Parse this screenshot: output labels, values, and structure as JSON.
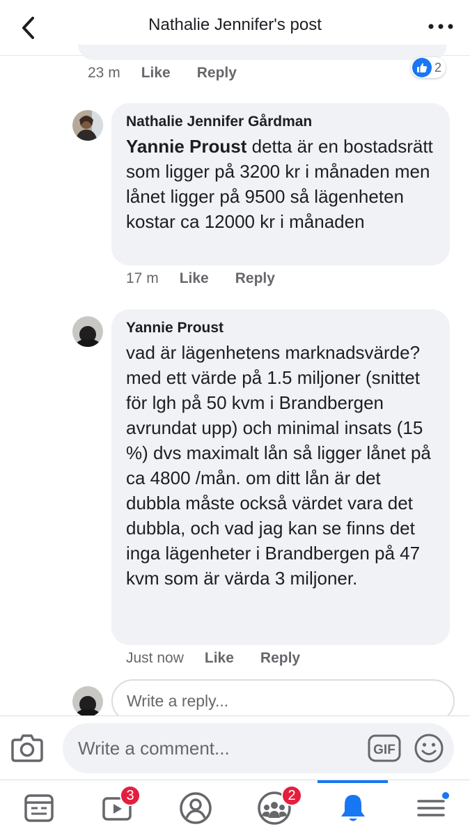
{
  "header": {
    "title": "Nathalie Jennifer's post",
    "back_icon": "chevron-left-icon",
    "more_icon": "more-horizontal-icon"
  },
  "previous_comment": {
    "time": "23 m",
    "like_label": "Like",
    "reply_label": "Reply",
    "reaction_count": "2"
  },
  "comments": [
    {
      "author": "Nathalie Jennifer Gårdman",
      "mention": "Yannie Proust",
      "text": " detta är en bostadsrätt som ligger på 3200 kr i månaden men lånet ligger på 9500 så lägenheten kostar ca 12000 kr i månaden",
      "time": "17 m",
      "like_label": "Like",
      "reply_label": "Reply"
    },
    {
      "author": "Yannie Proust",
      "text": "vad är lägenhetens marknadsvärde? med ett värde på 1.5 miljoner (snittet för lgh på 50 kvm i Brandbergen avrundat upp) och minimal insats (15 %) dvs maximalt lån så ligger lånet på ca 4800 /mån. om ditt lån är det dubbla måste också värdet vara det dubbla, och vad jag kan se finns det inga lägenheter i Brandbergen på 47 kvm som är värda 3 miljoner.",
      "time": "Just now",
      "like_label": "Like",
      "reply_label": "Reply"
    }
  ],
  "reply_box": {
    "placeholder": "Write a reply..."
  },
  "comment_bar": {
    "placeholder": "Write a comment...",
    "gif_label": "GIF"
  },
  "tab_bar": {
    "tabs": [
      {
        "icon": "news-feed-icon",
        "badge": ""
      },
      {
        "icon": "watch-video-icon",
        "badge": "3"
      },
      {
        "icon": "profile-icon",
        "badge": ""
      },
      {
        "icon": "groups-icon",
        "badge": "2"
      },
      {
        "icon": "notifications-bell-icon",
        "badge": "",
        "active": true
      },
      {
        "icon": "menu-icon",
        "badge": ""
      }
    ]
  },
  "colors": {
    "accent": "#1877f2",
    "bubble": "#f0f2f5",
    "badge": "#e41e3f",
    "secondary_text": "#65676b"
  }
}
